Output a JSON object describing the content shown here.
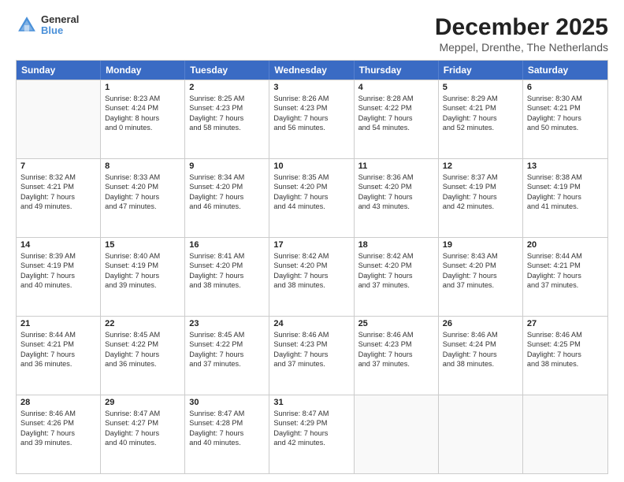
{
  "logo": {
    "line1": "General",
    "line2": "Blue"
  },
  "title": "December 2025",
  "subtitle": "Meppel, Drenthe, The Netherlands",
  "weekdays": [
    "Sunday",
    "Monday",
    "Tuesday",
    "Wednesday",
    "Thursday",
    "Friday",
    "Saturday"
  ],
  "rows": [
    [
      {
        "day": "",
        "lines": []
      },
      {
        "day": "1",
        "lines": [
          "Sunrise: 8:23 AM",
          "Sunset: 4:24 PM",
          "Daylight: 8 hours",
          "and 0 minutes."
        ]
      },
      {
        "day": "2",
        "lines": [
          "Sunrise: 8:25 AM",
          "Sunset: 4:23 PM",
          "Daylight: 7 hours",
          "and 58 minutes."
        ]
      },
      {
        "day": "3",
        "lines": [
          "Sunrise: 8:26 AM",
          "Sunset: 4:23 PM",
          "Daylight: 7 hours",
          "and 56 minutes."
        ]
      },
      {
        "day": "4",
        "lines": [
          "Sunrise: 8:28 AM",
          "Sunset: 4:22 PM",
          "Daylight: 7 hours",
          "and 54 minutes."
        ]
      },
      {
        "day": "5",
        "lines": [
          "Sunrise: 8:29 AM",
          "Sunset: 4:21 PM",
          "Daylight: 7 hours",
          "and 52 minutes."
        ]
      },
      {
        "day": "6",
        "lines": [
          "Sunrise: 8:30 AM",
          "Sunset: 4:21 PM",
          "Daylight: 7 hours",
          "and 50 minutes."
        ]
      }
    ],
    [
      {
        "day": "7",
        "lines": [
          "Sunrise: 8:32 AM",
          "Sunset: 4:21 PM",
          "Daylight: 7 hours",
          "and 49 minutes."
        ]
      },
      {
        "day": "8",
        "lines": [
          "Sunrise: 8:33 AM",
          "Sunset: 4:20 PM",
          "Daylight: 7 hours",
          "and 47 minutes."
        ]
      },
      {
        "day": "9",
        "lines": [
          "Sunrise: 8:34 AM",
          "Sunset: 4:20 PM",
          "Daylight: 7 hours",
          "and 46 minutes."
        ]
      },
      {
        "day": "10",
        "lines": [
          "Sunrise: 8:35 AM",
          "Sunset: 4:20 PM",
          "Daylight: 7 hours",
          "and 44 minutes."
        ]
      },
      {
        "day": "11",
        "lines": [
          "Sunrise: 8:36 AM",
          "Sunset: 4:20 PM",
          "Daylight: 7 hours",
          "and 43 minutes."
        ]
      },
      {
        "day": "12",
        "lines": [
          "Sunrise: 8:37 AM",
          "Sunset: 4:19 PM",
          "Daylight: 7 hours",
          "and 42 minutes."
        ]
      },
      {
        "day": "13",
        "lines": [
          "Sunrise: 8:38 AM",
          "Sunset: 4:19 PM",
          "Daylight: 7 hours",
          "and 41 minutes."
        ]
      }
    ],
    [
      {
        "day": "14",
        "lines": [
          "Sunrise: 8:39 AM",
          "Sunset: 4:19 PM",
          "Daylight: 7 hours",
          "and 40 minutes."
        ]
      },
      {
        "day": "15",
        "lines": [
          "Sunrise: 8:40 AM",
          "Sunset: 4:19 PM",
          "Daylight: 7 hours",
          "and 39 minutes."
        ]
      },
      {
        "day": "16",
        "lines": [
          "Sunrise: 8:41 AM",
          "Sunset: 4:20 PM",
          "Daylight: 7 hours",
          "and 38 minutes."
        ]
      },
      {
        "day": "17",
        "lines": [
          "Sunrise: 8:42 AM",
          "Sunset: 4:20 PM",
          "Daylight: 7 hours",
          "and 38 minutes."
        ]
      },
      {
        "day": "18",
        "lines": [
          "Sunrise: 8:42 AM",
          "Sunset: 4:20 PM",
          "Daylight: 7 hours",
          "and 37 minutes."
        ]
      },
      {
        "day": "19",
        "lines": [
          "Sunrise: 8:43 AM",
          "Sunset: 4:20 PM",
          "Daylight: 7 hours",
          "and 37 minutes."
        ]
      },
      {
        "day": "20",
        "lines": [
          "Sunrise: 8:44 AM",
          "Sunset: 4:21 PM",
          "Daylight: 7 hours",
          "and 37 minutes."
        ]
      }
    ],
    [
      {
        "day": "21",
        "lines": [
          "Sunrise: 8:44 AM",
          "Sunset: 4:21 PM",
          "Daylight: 7 hours",
          "and 36 minutes."
        ]
      },
      {
        "day": "22",
        "lines": [
          "Sunrise: 8:45 AM",
          "Sunset: 4:22 PM",
          "Daylight: 7 hours",
          "and 36 minutes."
        ]
      },
      {
        "day": "23",
        "lines": [
          "Sunrise: 8:45 AM",
          "Sunset: 4:22 PM",
          "Daylight: 7 hours",
          "and 37 minutes."
        ]
      },
      {
        "day": "24",
        "lines": [
          "Sunrise: 8:46 AM",
          "Sunset: 4:23 PM",
          "Daylight: 7 hours",
          "and 37 minutes."
        ]
      },
      {
        "day": "25",
        "lines": [
          "Sunrise: 8:46 AM",
          "Sunset: 4:23 PM",
          "Daylight: 7 hours",
          "and 37 minutes."
        ]
      },
      {
        "day": "26",
        "lines": [
          "Sunrise: 8:46 AM",
          "Sunset: 4:24 PM",
          "Daylight: 7 hours",
          "and 38 minutes."
        ]
      },
      {
        "day": "27",
        "lines": [
          "Sunrise: 8:46 AM",
          "Sunset: 4:25 PM",
          "Daylight: 7 hours",
          "and 38 minutes."
        ]
      }
    ],
    [
      {
        "day": "28",
        "lines": [
          "Sunrise: 8:46 AM",
          "Sunset: 4:26 PM",
          "Daylight: 7 hours",
          "and 39 minutes."
        ]
      },
      {
        "day": "29",
        "lines": [
          "Sunrise: 8:47 AM",
          "Sunset: 4:27 PM",
          "Daylight: 7 hours",
          "and 40 minutes."
        ]
      },
      {
        "day": "30",
        "lines": [
          "Sunrise: 8:47 AM",
          "Sunset: 4:28 PM",
          "Daylight: 7 hours",
          "and 40 minutes."
        ]
      },
      {
        "day": "31",
        "lines": [
          "Sunrise: 8:47 AM",
          "Sunset: 4:29 PM",
          "Daylight: 7 hours",
          "and 42 minutes."
        ]
      },
      {
        "day": "",
        "lines": []
      },
      {
        "day": "",
        "lines": []
      },
      {
        "day": "",
        "lines": []
      }
    ]
  ]
}
